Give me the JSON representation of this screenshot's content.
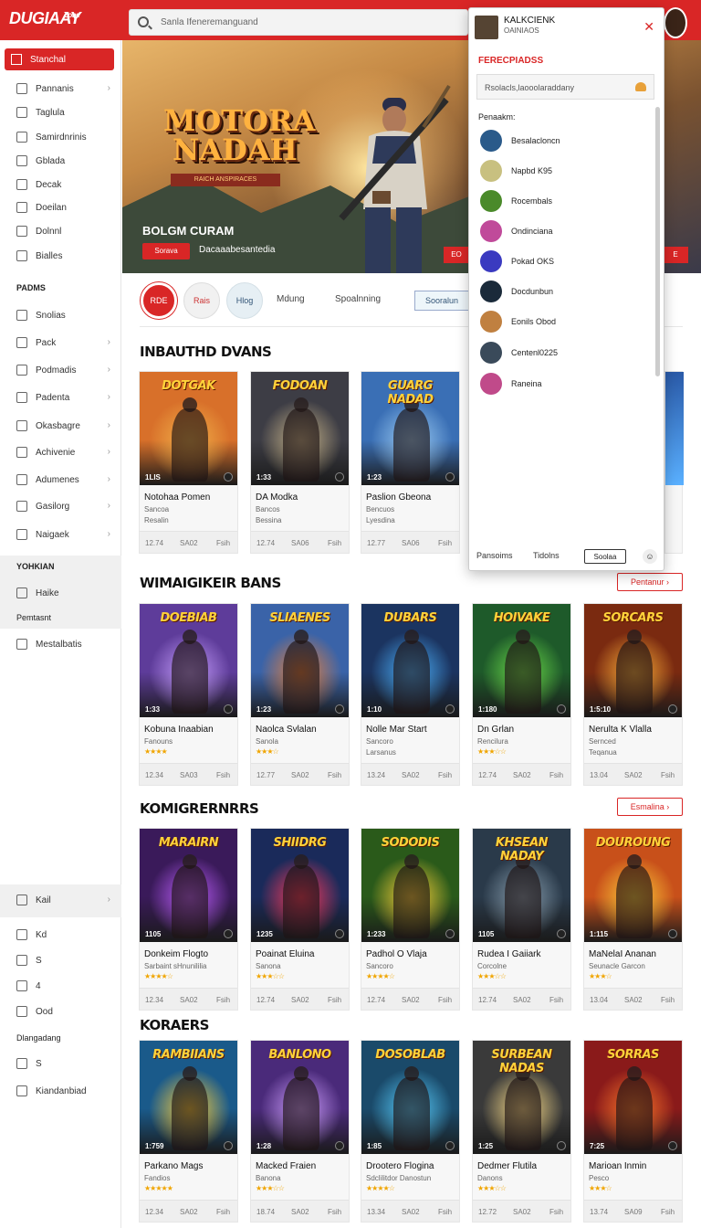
{
  "brand": {
    "logo": "DUGIAAY",
    "tagline": "Zone"
  },
  "search": {
    "placeholder": "Sanla Ifeneremanguand"
  },
  "sidebar": {
    "active": "Stanchal",
    "items": [
      "Pannanis",
      "Taglula",
      "Samirdnrinis",
      "Gblada",
      "Decak",
      "Doeilan",
      "Dolnnl",
      "Bialles"
    ],
    "head1": "PADMS",
    "items2": [
      "Snolias",
      "Pack",
      "Podmadis",
      "Padenta",
      "Okasbagre",
      "Achivenie",
      "Adumenes",
      "Gasilorg",
      "Naigaek"
    ],
    "head2": "YOHKIAN",
    "items3": [
      "Haike"
    ],
    "item3b": "Pemtasnt",
    "items4": [
      "Mestalbatis"
    ],
    "items5": [
      "Kail",
      "Kd",
      "S",
      "4",
      "Ood"
    ],
    "head3": "Dlangadang",
    "items6": [
      "S",
      "Kiandanbiad"
    ]
  },
  "hero": {
    "title_line1": "MOTORA",
    "title_line2": "NADAH",
    "ribbon": "RAICH ANSPIRACES",
    "name": "BOLGM CURAM",
    "button": "Sorava",
    "subtitle": "Dacaaabesantedia",
    "right_btn1": "EO",
    "right_btn2": "E"
  },
  "filters": [
    {
      "label": "RDE"
    },
    {
      "label": "Rais"
    },
    {
      "label": "Hlog"
    }
  ],
  "filter_text": [
    "Mdung",
    "Spoalnning"
  ],
  "filter_box": "Sooralun",
  "sections": [
    {
      "title": "INBAUTHD DVANS",
      "more": ""
    },
    {
      "title": "WIMAIGIKEIR BANS",
      "more": "Pentanur"
    },
    {
      "title": "KOMIGRERNRRS",
      "more": "Esmalina"
    },
    {
      "title": "KORAERS",
      "more": ""
    }
  ],
  "cards": [
    [
      {
        "logo": "DOTGAK",
        "num": "1LIS",
        "name": "Notohaa Pomen",
        "sub": "Sancoa",
        "sub2": "Resalin",
        "m1": "12.74",
        "m2": "SA02",
        "m3": "Fsih",
        "c": "#d8702a",
        "g": "#f2b24a"
      },
      {
        "logo": "FODOAN",
        "num": "1:33",
        "name": "DA Modka",
        "sub": "Bancos",
        "sub2": "Bessina",
        "m1": "12.74",
        "m2": "SA06",
        "m3": "Fsih",
        "c": "#3d3d45",
        "g": "#c9b58a"
      },
      {
        "logo": "GUARG NADAD",
        "num": "1:23",
        "name": "Paslion Gbeona",
        "sub": "Bencuos",
        "sub2": "Lyesdina",
        "m1": "12.77",
        "m2": "SA06",
        "m3": "Fsih",
        "c": "#3a6fb5",
        "g": "#9fcff5"
      }
    ],
    [
      {
        "logo": "DOEBIAB",
        "num": "1:33",
        "name": "Kobuna Inaabian",
        "sub": "Fanouns",
        "sub2": "",
        "m1": "12.34",
        "m2": "SA03",
        "m3": "Fsih",
        "c": "#5e3c9a",
        "g": "#c8a0ff",
        "stars": "★★★★"
      },
      {
        "logo": "SLIAENES",
        "num": "1:23",
        "name": "Naolca Svlalan",
        "sub": "Sanola",
        "sub2": "",
        "m1": "12.77",
        "m2": "SA02",
        "m3": "Fsih",
        "c": "#3a63a8",
        "g": "#e8803a",
        "stars": "★★★☆"
      },
      {
        "logo": "DUBARS",
        "num": "1:10",
        "name": "Nolle Mar Start",
        "sub": "Sancoro",
        "sub2": "Larsanus",
        "m1": "13.24",
        "m2": "SA02",
        "m3": "Fsih",
        "c": "#1b3460",
        "g": "#4db4ff",
        "stars": ""
      },
      {
        "logo": "HOIVAKE",
        "num": "1:180",
        "name": "Dn Grlan",
        "sub": "Rencilura",
        "sub2": "",
        "m1": "12.74",
        "m2": "SA02",
        "m3": "Fsih",
        "c": "#1e5a2a",
        "g": "#6ee04a",
        "stars": "★★★☆☆"
      },
      {
        "logo": "SORCARS",
        "num": "1:5:10",
        "name": "Nerulta K Vlalla",
        "sub": "Sernced",
        "sub2": "Teqanua",
        "m1": "13.04",
        "m2": "SA02",
        "m3": "Fsih",
        "c": "#7a2a10",
        "g": "#ffb23a",
        "stars": ""
      }
    ],
    [
      {
        "logo": "MARAIRN",
        "num": "1105",
        "name": "Donkeim Flogto",
        "sub": "Sarbaint sHnunililia",
        "sub2": "",
        "m1": "12.34",
        "m2": "SA02",
        "m3": "Fsih",
        "c": "#3a1a5a",
        "g": "#c060ff",
        "stars": "★★★★☆"
      },
      {
        "logo": "SHIIDRG",
        "num": "1235",
        "name": "Poainat Eluina",
        "sub": "Sanona",
        "sub2": "",
        "m1": "12.74",
        "m2": "SA02",
        "m3": "Fsih",
        "c": "#1a2a5a",
        "g": "#ff3a5a",
        "stars": "★★★☆☆"
      },
      {
        "logo": "SODODIS",
        "num": "1:233",
        "name": "Padhol O Vlaja",
        "sub": "Sancoro",
        "sub2": "",
        "m1": "12.74",
        "m2": "SA02",
        "m3": "Fsih",
        "c": "#2a5a1a",
        "g": "#ffd23a",
        "stars": "★★★★☆"
      },
      {
        "logo": "KHSEAN NADAY",
        "num": "1105",
        "name": "Rudea I Gaiiark",
        "sub": "Corcolne",
        "sub2": "",
        "m1": "12.74",
        "m2": "SA02",
        "m3": "Fsih",
        "c": "#2a3a4a",
        "g": "#8aa0b0",
        "stars": "★★★☆☆"
      },
      {
        "logo": "DOUROUNG",
        "num": "1:115",
        "name": "MaNelaI Ananan",
        "sub": "Seunacle Garcon",
        "sub2": "",
        "m1": "13.04",
        "m2": "SA02",
        "m3": "Fsih",
        "c": "#c8501a",
        "g": "#ffcf3a",
        "stars": "★★★☆"
      }
    ],
    [
      {
        "logo": "RAMBIIANS",
        "num": "1:759",
        "name": "Parkano Mags",
        "sub": "Fandios",
        "sub2": "",
        "m1": "12.34",
        "m2": "SA02",
        "m3": "Fsih",
        "c": "#1a5a8a",
        "g": "#ffcf3a",
        "stars": "★★★★★"
      },
      {
        "logo": "BANLONO",
        "num": "1:28",
        "name": "Macked Fraien",
        "sub": "Banona",
        "sub2": "",
        "m1": "18.74",
        "m2": "SA02",
        "m3": "Fsih",
        "c": "#4a2a7a",
        "g": "#d0a0ff",
        "stars": "★★★☆☆"
      },
      {
        "logo": "DOSOBLAB",
        "num": "1:85",
        "name": "Drootero Flogina",
        "sub": "Sdclilitdor Danostun",
        "sub2": "",
        "m1": "13.34",
        "m2": "SA02",
        "m3": "Fsih",
        "c": "#1a4a6a",
        "g": "#5ad0ff",
        "stars": "★★★★☆"
      },
      {
        "logo": "SURBEAN NADAS",
        "num": "1:25",
        "name": "Dedmer Flutila",
        "sub": "Danons",
        "sub2": "",
        "m1": "12.72",
        "m2": "SA02",
        "m3": "Fsih",
        "c": "#3a3a3a",
        "g": "#ffe08a",
        "stars": "★★★☆☆"
      },
      {
        "logo": "SORRAS",
        "num": "7:25",
        "name": "Marioan Inmin",
        "sub": "Pesco",
        "sub2": "",
        "m1": "13.74",
        "m2": "SA09",
        "m3": "Fsih",
        "c": "#8a1a1a",
        "g": "#ff7a2a",
        "stars": "★★★☆"
      }
    ]
  ],
  "popup": {
    "title": "KALKCIENK",
    "subtitle": "OAINIAOS",
    "section": "FERECPIADSS",
    "input": "Rsolacls,laooolaraddany",
    "label": "Penaakm:",
    "rows": [
      {
        "name": "Besalacloncn",
        "color": "#2a5a8a"
      },
      {
        "name": "Napbd K95",
        "color": "#c8c080"
      },
      {
        "name": "Rocembals",
        "color": "#4a8a2a"
      },
      {
        "name": "Ondinciana",
        "color": "#c04a9a"
      },
      {
        "name": "Pokad OKS",
        "color": "#3a3ac0"
      },
      {
        "name": "Docdunbun",
        "color": "#1a2a3a"
      },
      {
        "name": "Eonils Obod",
        "color": "#c08040"
      },
      {
        "name": "Centenl0225",
        "color": "#3a4a5a"
      },
      {
        "name": "Raneina",
        "color": "#c04a8a"
      }
    ],
    "foot1": "Pansoims",
    "foot2": "Tidolns",
    "button": "Soolaa"
  },
  "colors": {
    "brand": "#d92626",
    "accent_star": "#f0a500"
  }
}
